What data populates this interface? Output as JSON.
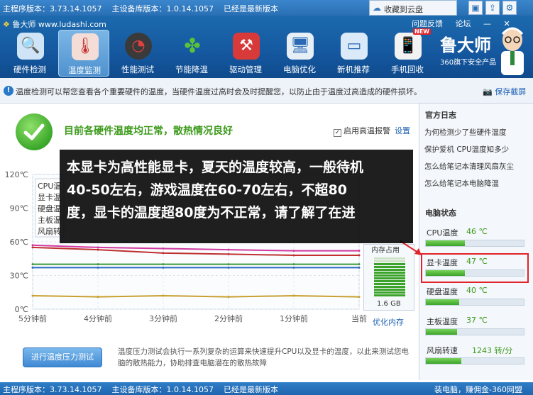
{
  "topbar": {
    "program_version": "主程序版本：3.73.14.1057",
    "device_db_version": "主设备库版本：1.0.14.1057",
    "latest_status": "已经是最新版本",
    "cloud_save": "收藏到云盘"
  },
  "header": {
    "logo": "鲁大师 www.ludashi.com",
    "links": [
      "问题反馈",
      "论坛"
    ],
    "brand": "鲁大师",
    "brand_sub": "360旗下安全产品",
    "new_badge": "NEW"
  },
  "nav": [
    {
      "label": "硬件检测",
      "icon": "monitor-magnifier-icon",
      "color": "#4a9ad8"
    },
    {
      "label": "温度监测",
      "icon": "thermometer-icon",
      "color": "#d84a3a"
    },
    {
      "label": "性能测试",
      "icon": "speedometer-icon",
      "color": "#c23030"
    },
    {
      "label": "节能降温",
      "icon": "leaf-icon",
      "color": "#3aa83a"
    },
    {
      "label": "驱动管理",
      "icon": "toolbox-icon",
      "color": "#d83a3a"
    },
    {
      "label": "电脑优化",
      "icon": "computer-icon",
      "color": "#4a8ad8"
    },
    {
      "label": "新机推荐",
      "icon": "pc-screen-icon",
      "color": "#3a9ad8"
    },
    {
      "label": "手机回收",
      "icon": "phone-icon",
      "color": "#e0e0e0"
    }
  ],
  "infobar": {
    "text": "温度检测可以帮您查看各个重要硬件的温度，当硬件温度过高时会及时提醒您，以防止由于温度过高造成的硬件损坏。",
    "save_screenshot": "保存截屏"
  },
  "main": {
    "status": "目前各硬件温度均正常，散热情况良好",
    "alarm_label": "启用高温报警",
    "settings": "设置",
    "memory_label": "内存占用",
    "memory_size": "1.6 GB",
    "optimize_memory": "优化内存",
    "stress_button": "进行温度压力测试",
    "stress_desc": "温度压力测试会执行一系列复杂的运算来快速提升CPU以及显卡的温度，以此来测试您电脑的散热能力，协助排查电脑潜在的散热故障"
  },
  "chart_data": {
    "type": "line",
    "x": [
      "5分钟前",
      "4分钟前",
      "3分钟前",
      "2分钟前",
      "1分钟前",
      "当前"
    ],
    "yticks": [
      "0℃",
      "30℃",
      "60℃",
      "90℃",
      "120℃"
    ],
    "ylim": [
      0,
      120
    ],
    "legend_partial": [
      "CPU温",
      "显卡温",
      "硬盘温",
      "主板温",
      "风扇转"
    ],
    "series": [
      {
        "name": "CPU温",
        "color": "#d03aa0",
        "values": [
          57,
          55,
          54,
          53,
          52,
          52
        ]
      },
      {
        "name": "显卡温",
        "color": "#c03030",
        "values": [
          55,
          53,
          50,
          49,
          48,
          48
        ]
      },
      {
        "name": "硬盘温",
        "color": "#3a9a3a",
        "values": [
          40,
          40,
          40,
          40,
          40,
          40
        ]
      },
      {
        "name": "主板温",
        "color": "#2a6ac0",
        "values": [
          37,
          37,
          37,
          37,
          37,
          37
        ]
      },
      {
        "name": "风扇转",
        "color": "#c8a030",
        "values": [
          12,
          11,
          12,
          11,
          12,
          11
        ]
      }
    ],
    "memory_usage_percent": 85
  },
  "overlay": {
    "lines": [
      "本显卡为高性能显卡，夏天的温度较高，一般待机",
      "40-50左右，游戏温度在60-70左右，不超80",
      "度，显卡的温度超80度为不正常，请了解了在进"
    ]
  },
  "side": {
    "log_title": "官方日志",
    "news": [
      "为何检测少了些硬件温度",
      "保护爱机 CPU温度知多少",
      "怎么给笔记本清理风扇灰尘",
      "怎么给笔记本电脑降温"
    ],
    "status_title": "电脑状态",
    "sensors": [
      {
        "name": "CPU温度",
        "value": "46 ℃",
        "level": 0.4
      },
      {
        "name": "显卡温度",
        "value": "47 ℃",
        "level": 0.4
      },
      {
        "name": "硬盘温度",
        "value": "40 ℃",
        "level": 0.34
      },
      {
        "name": "主板温度",
        "value": "37 ℃",
        "level": 0.32
      },
      {
        "name": "风扇转速",
        "value": "1243 转/分",
        "level": 0.36
      }
    ]
  },
  "bottombar": {
    "program_version": "主程序版本：3.73.14.1057",
    "device_db_version": "主设备库版本：1.0.14.1057",
    "latest_status": "已经是最新版本",
    "promo": "装电脑，赚佣金-360网盟"
  }
}
